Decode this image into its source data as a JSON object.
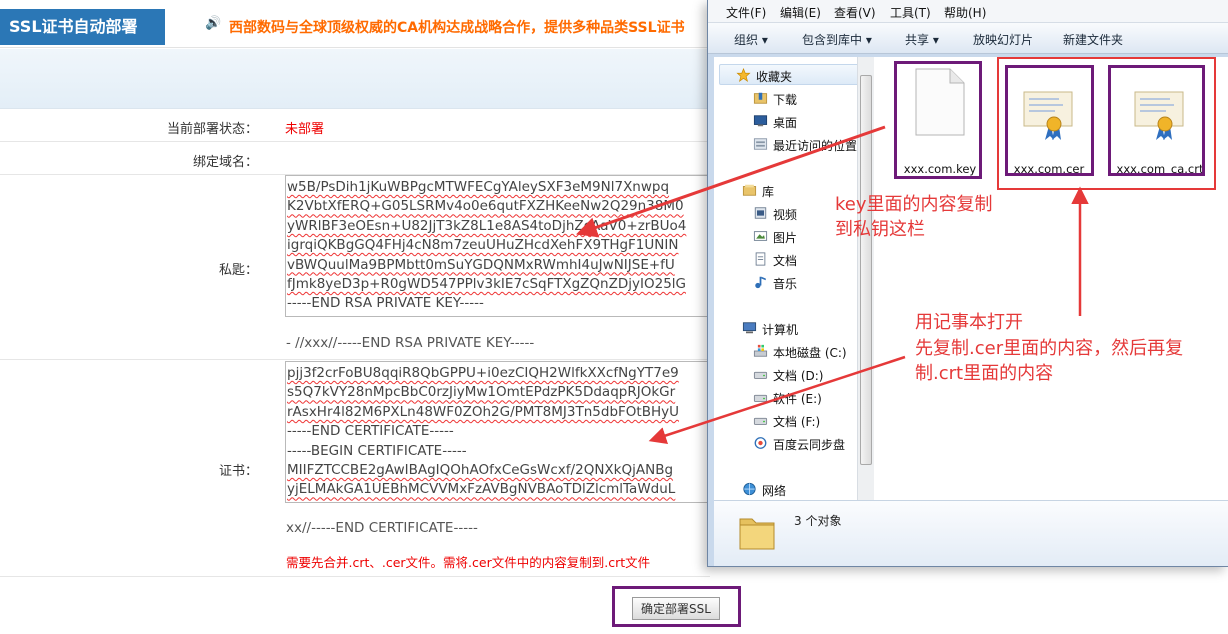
{
  "header": {
    "title": "SSL证书自动部署",
    "notice": "西部数码与全球顶级权威的CA机构达成战略合作，提供多种品类SSL证书"
  },
  "form": {
    "status_label": "当前部署状态：",
    "status_value": "未部署",
    "domain_label": "绑定域名：",
    "private_key_label": "私匙：",
    "private_key_lines": [
      "w5B/PsDih1jKuWBPgcMTWFECgYAleySXF3eM9Nl7Xnwpq",
      "K2VbtXfERQ+G05LSRMv4o0e6qutFXZHKeeNw2Q29n38M0",
      "yWRlBF3eOEsn+U82JjT3kZ8L1e8AS4toDjhZcAaV0+zrBUo4",
      "igrqiQKBgGQ4FHj4cN8m7zeuUHuZHcdXehFX9THgF1UNIN",
      "vBWQuulMa9BPMbtt0mSuYGDQNMxRWmhI4uJwNIJSE+fU",
      "fJmk8yeD3p+R0gWD547PPlv3kIE7cSqFTXgZQnZDjyIO25lG",
      "-----END RSA PRIVATE KEY-----"
    ],
    "private_key_after": "- //xxx//-----END RSA PRIVATE KEY-----",
    "cert_label": "证书：",
    "cert_lines": [
      "pjj3f2crFoBU8qqiR8QbGPPU+i0ezCIQH2WlfkXXcfNgYT7e9",
      "s5Q7kVY28nMpcBbC0rzJiyMw1OmtEPdzPK5DdaqpRJOkGr",
      "rAsxHr4l82M6PXLn48WF0ZOh2G/PMT8MJ3Tn5dbFOtBHyU",
      "-----END CERTIFICATE-----",
      "-----BEGIN CERTIFICATE-----",
      "MIIFZTCCBE2gAwIBAgIQOhAOfxCeGsWcxf/2QNXkQjANBg",
      "yjELMAkGA1UEBhMCVVMxFzAVBgNVBAoTDlZlcmlTaWduL"
    ],
    "cert_after": "xx//-----END CERTIFICATE-----",
    "warning": "需要先合并.crt、.cer文件。需将.cer文件中的内容复制到.crt文件",
    "deploy_button": "确定部署SSL"
  },
  "explorer": {
    "menu": [
      "文件(F)",
      "编辑(E)",
      "查看(V)",
      "工具(T)",
      "帮助(H)"
    ],
    "toolbar": [
      "组织 ▾",
      "包含到库中 ▾",
      "共享 ▾",
      "放映幻灯片",
      "新建文件夹"
    ],
    "nav": {
      "favorites": "收藏夹",
      "downloads": "下载",
      "desktop": "桌面",
      "recent": "最近访问的位置",
      "libraries": "库",
      "videos": "视频",
      "pictures": "图片",
      "documents": "文档",
      "music": "音乐",
      "computer": "计算机",
      "drive_c": "本地磁盘 (C:)",
      "drive_d": "文档 (D:)",
      "drive_e": "软件 (E:)",
      "drive_f": "文档 (F:)",
      "baidu": "百度云同步盘",
      "network": "网络"
    },
    "files": {
      "key": "xxx.com.key",
      "cer": "xxx.com.cer",
      "crt": "xxx.com_ca.crt"
    },
    "item_count": "3 个对象"
  },
  "annotations": {
    "key_note_line1": "key里面的内容复制",
    "key_note_line2": "到私钥这栏",
    "cert_note_line1": "用记事本打开",
    "cert_note_line2": "先复制.cer里面的内容，然后再复",
    "cert_note_line3": "制.crt里面的内容"
  },
  "colors": {
    "accent_blue": "#2b77b6",
    "notice_orange": "#ff6a00",
    "annotation_red": "#e53939",
    "highlight_purple": "#6d1a78"
  }
}
